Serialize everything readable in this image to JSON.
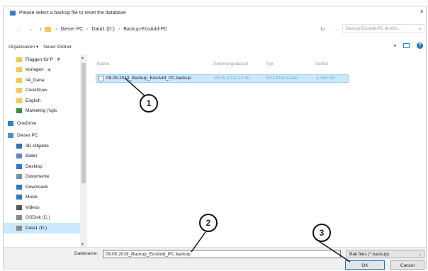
{
  "dialog": {
    "title": "Please select a backup file to reset the database",
    "close_glyph": "×"
  },
  "address": {
    "back_glyph": "←",
    "forward_glyph": "→",
    "up_glyph": "↑",
    "crumbs": [
      "Dieser PC",
      "Data1 (D:)",
      "Backup-EcoAdd-PC"
    ],
    "separator": "›",
    "refresh_glyph": "↻",
    "search_placeholder": "Backup-EcoAdd-PC durchs...",
    "search_icon_glyph": "⌕"
  },
  "toolbar": {
    "organize_label": "Organisieren ▾",
    "new_folder_label": "Neuer Ordner"
  },
  "sidebar": {
    "items": [
      {
        "label": "Flaggen für P",
        "icon": "folder-icon",
        "pin": "✱"
      },
      {
        "label": "Vorlagen",
        "icon": "folder-icon",
        "pin": "✱"
      },
      {
        "label": "04_Dana",
        "icon": "folder-icon"
      },
      {
        "label": "CorelDraw",
        "icon": "folder-icon"
      },
      {
        "label": "English",
        "icon": "folder-icon"
      },
      {
        "label": "Marketing (\\\\glc",
        "icon": "network-drive-icon"
      },
      {
        "label": "OneDrive",
        "icon": "cloud-icon"
      },
      {
        "label": "Dieser PC",
        "icon": "computer-icon"
      },
      {
        "label": "3D-Objekte",
        "icon": "cube-icon"
      },
      {
        "label": "Bilder",
        "icon": "pictures-icon"
      },
      {
        "label": "Desktop",
        "icon": "desktop-icon"
      },
      {
        "label": "Dokumente",
        "icon": "documents-icon"
      },
      {
        "label": "Downloads",
        "icon": "download-icon"
      },
      {
        "label": "Musik",
        "icon": "music-icon"
      },
      {
        "label": "Videos",
        "icon": "video-icon"
      },
      {
        "label": "OSDisk (C:)",
        "icon": "disk-icon"
      },
      {
        "label": "Data1 (D:)",
        "icon": "disk-icon"
      }
    ]
  },
  "columns": [
    "Name",
    "Änderungsdatum",
    "Typ",
    "Größe"
  ],
  "files": [
    {
      "name": "09.05.2019_Backup_EcoAdd_PC.backup",
      "date": "09.05.2019 13:40",
      "type": "BACKUP-Datei",
      "size": "4.465 KB"
    }
  ],
  "bottom": {
    "filename_label": "Dateiname:",
    "filename_value": "09.05.2019_Backup_EcoAdd_PC.backup",
    "filter_value": "Bak files (*.backup)",
    "ok_label": "OK",
    "cancel_label": "Cancel"
  },
  "callouts": [
    "1",
    "2",
    "3"
  ],
  "colors": {
    "selection": "#cce8ff",
    "accent": "#0078d7",
    "folder": "#f2c94c"
  }
}
